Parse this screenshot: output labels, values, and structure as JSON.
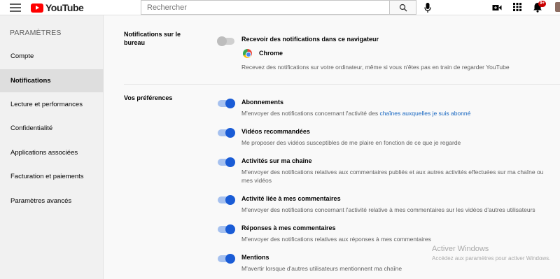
{
  "header": {
    "logo_text": "YouTube",
    "search_placeholder": "Rechercher",
    "notification_count": "9+"
  },
  "sidebar": {
    "heading": "PARAMÈTRES",
    "items": [
      {
        "label": "Compte"
      },
      {
        "label": "Notifications"
      },
      {
        "label": "Lecture et performances"
      },
      {
        "label": "Confidentialité"
      },
      {
        "label": "Applications associées"
      },
      {
        "label": "Facturation et paiements"
      },
      {
        "label": "Paramètres avancés"
      }
    ]
  },
  "main": {
    "desktop": {
      "section_label": "Notifications sur le bureau",
      "title": "Recevoir des notifications dans ce navigateur",
      "enabled": false,
      "browser_name": "Chrome",
      "description": "Recevez des notifications sur votre ordinateur, même si vous n'êtes pas en train de regarder YouTube"
    },
    "preferences": {
      "section_label": "Vos préférences",
      "items": [
        {
          "title": "Abonnements",
          "enabled": true,
          "desc_before_link": "M'envoyer des notifications concernant l'activité des ",
          "link": "chaînes auxquelles je suis abonné",
          "desc": ""
        },
        {
          "title": "Vidéos recommandées",
          "enabled": true,
          "desc": "Me proposer des vidéos susceptibles de me plaire en fonction de ce que je regarde"
        },
        {
          "title": "Activités sur ma chaîne",
          "enabled": true,
          "desc": "M'envoyer des notifications relatives aux commentaires publiés et aux autres activités effectuées sur ma chaîne ou",
          "desc_line2": "mes vidéos"
        },
        {
          "title": "Activité liée à mes commentaires",
          "enabled": true,
          "desc": "M'envoyer des notifications concernant l'activité relative à mes commentaires sur les vidéos d'autres utilisateurs"
        },
        {
          "title": "Réponses à mes commentaires",
          "enabled": true,
          "desc": "M'envoyer des notifications relatives aux réponses à mes commentaires"
        },
        {
          "title": "Mentions",
          "enabled": true,
          "desc": "M'avertir lorsque d'autres utilisateurs mentionnent ma chaîne"
        }
      ]
    }
  },
  "watermark": {
    "title": "Activer Windows",
    "subtitle": "Accédez aux paramètres pour activer Windows."
  },
  "colors": {
    "toggle_on_knob": "#1a5cd6",
    "toggle_on_track": "#a6c1ef",
    "link": "#1565c0",
    "logo_red": "#ff0000"
  }
}
